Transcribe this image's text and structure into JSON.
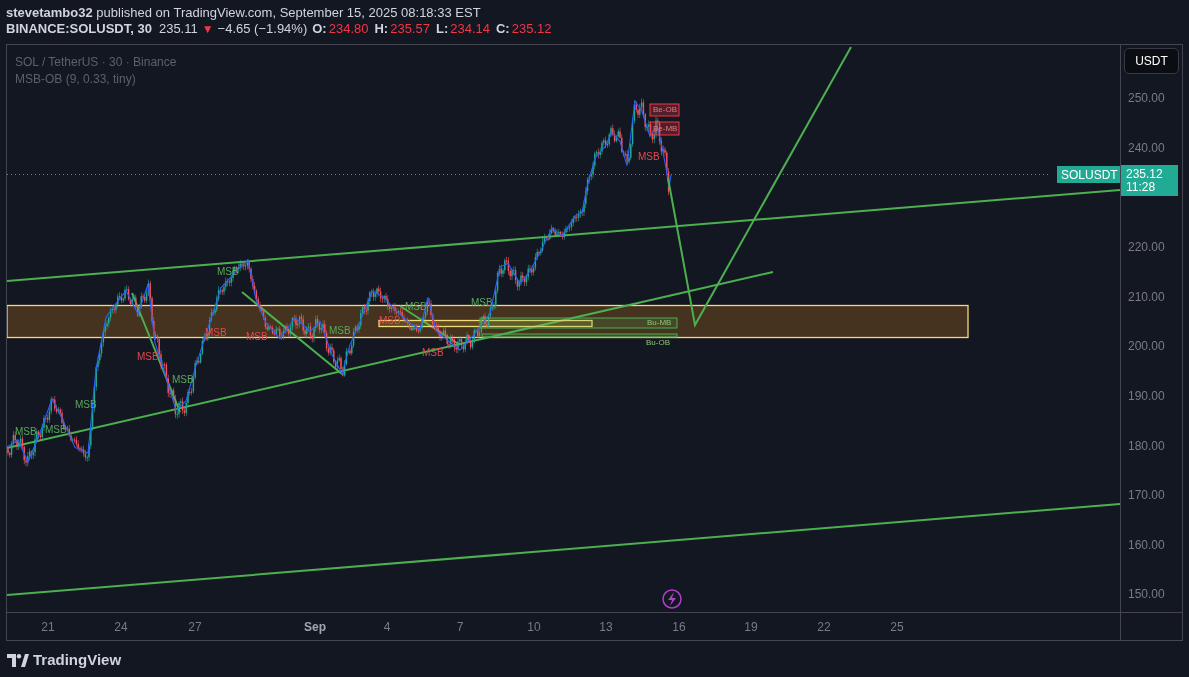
{
  "header": {
    "publisher_line": "**stevetambo32** published on TradingView.com, September 15, 2025 08:18:33 EST",
    "symbol": "BINANCE:SOLUSDT, 30",
    "last": "235.11",
    "falling": true,
    "arrow": "▼",
    "change": "−4.65 (−1.94%)",
    "ohlc": [
      {
        "label": "O:",
        "value": "234.80"
      },
      {
        "label": "H:",
        "value": "235.57"
      },
      {
        "label": "L:",
        "value": "234.14"
      },
      {
        "label": "C:",
        "value": "235.12"
      }
    ]
  },
  "chart": {
    "legend": [
      "SOL / TetherUS · 30 · Binance",
      "MSB-OB (9, 0.33, tiny)"
    ],
    "msb_labels": [
      {
        "text": "MSB",
        "kind": "bull"
      },
      {
        "text": "MSB",
        "kind": "bull"
      },
      {
        "text": "MSB",
        "kind": "bull"
      },
      {
        "text": "MSB",
        "kind": "bear"
      },
      {
        "text": "MSB",
        "kind": "bull"
      },
      {
        "text": "MSB",
        "kind": "bear"
      },
      {
        "text": "MSB",
        "kind": "bull"
      },
      {
        "text": "MSB",
        "kind": "bear"
      },
      {
        "text": "MSB",
        "kind": "bull"
      },
      {
        "text": "MSB",
        "kind": "bear"
      },
      {
        "text": "MSB",
        "kind": "bull"
      },
      {
        "text": "MSB",
        "kind": "bear"
      },
      {
        "text": "MSB",
        "kind": "bull"
      },
      {
        "text": "MSB",
        "kind": "bear"
      }
    ],
    "order_blocks": [
      {
        "label": "Be-OB",
        "kind": "bear"
      },
      {
        "label": "Be-MB",
        "kind": "bear"
      },
      {
        "label": "Bu-MB",
        "kind": "bull"
      },
      {
        "label": "Bu-OB",
        "kind": "bull"
      }
    ],
    "symbol_tag": "SOLUSDT"
  },
  "price_axis": {
    "currency_button": "USDT",
    "ticks": [
      "250.00",
      "240.00",
      "220.00",
      "210.00",
      "200.00",
      "190.00",
      "180.00",
      "170.00",
      "160.00",
      "150.00"
    ],
    "last_price": "235.12",
    "countdown": "11:28"
  },
  "time_axis": {
    "ticks": [
      {
        "label": "21",
        "kind": "day"
      },
      {
        "label": "24",
        "kind": "day"
      },
      {
        "label": "27",
        "kind": "day"
      },
      {
        "label": "Sep",
        "kind": "month"
      },
      {
        "label": "4",
        "kind": "day"
      },
      {
        "label": "7",
        "kind": "day"
      },
      {
        "label": "10",
        "kind": "day"
      },
      {
        "label": "13",
        "kind": "day"
      },
      {
        "label": "16",
        "kind": "day"
      },
      {
        "label": "19",
        "kind": "day"
      },
      {
        "label": "22",
        "kind": "day"
      },
      {
        "label": "25",
        "kind": "day"
      }
    ]
  },
  "footer": {
    "brand": "TradingView"
  }
}
